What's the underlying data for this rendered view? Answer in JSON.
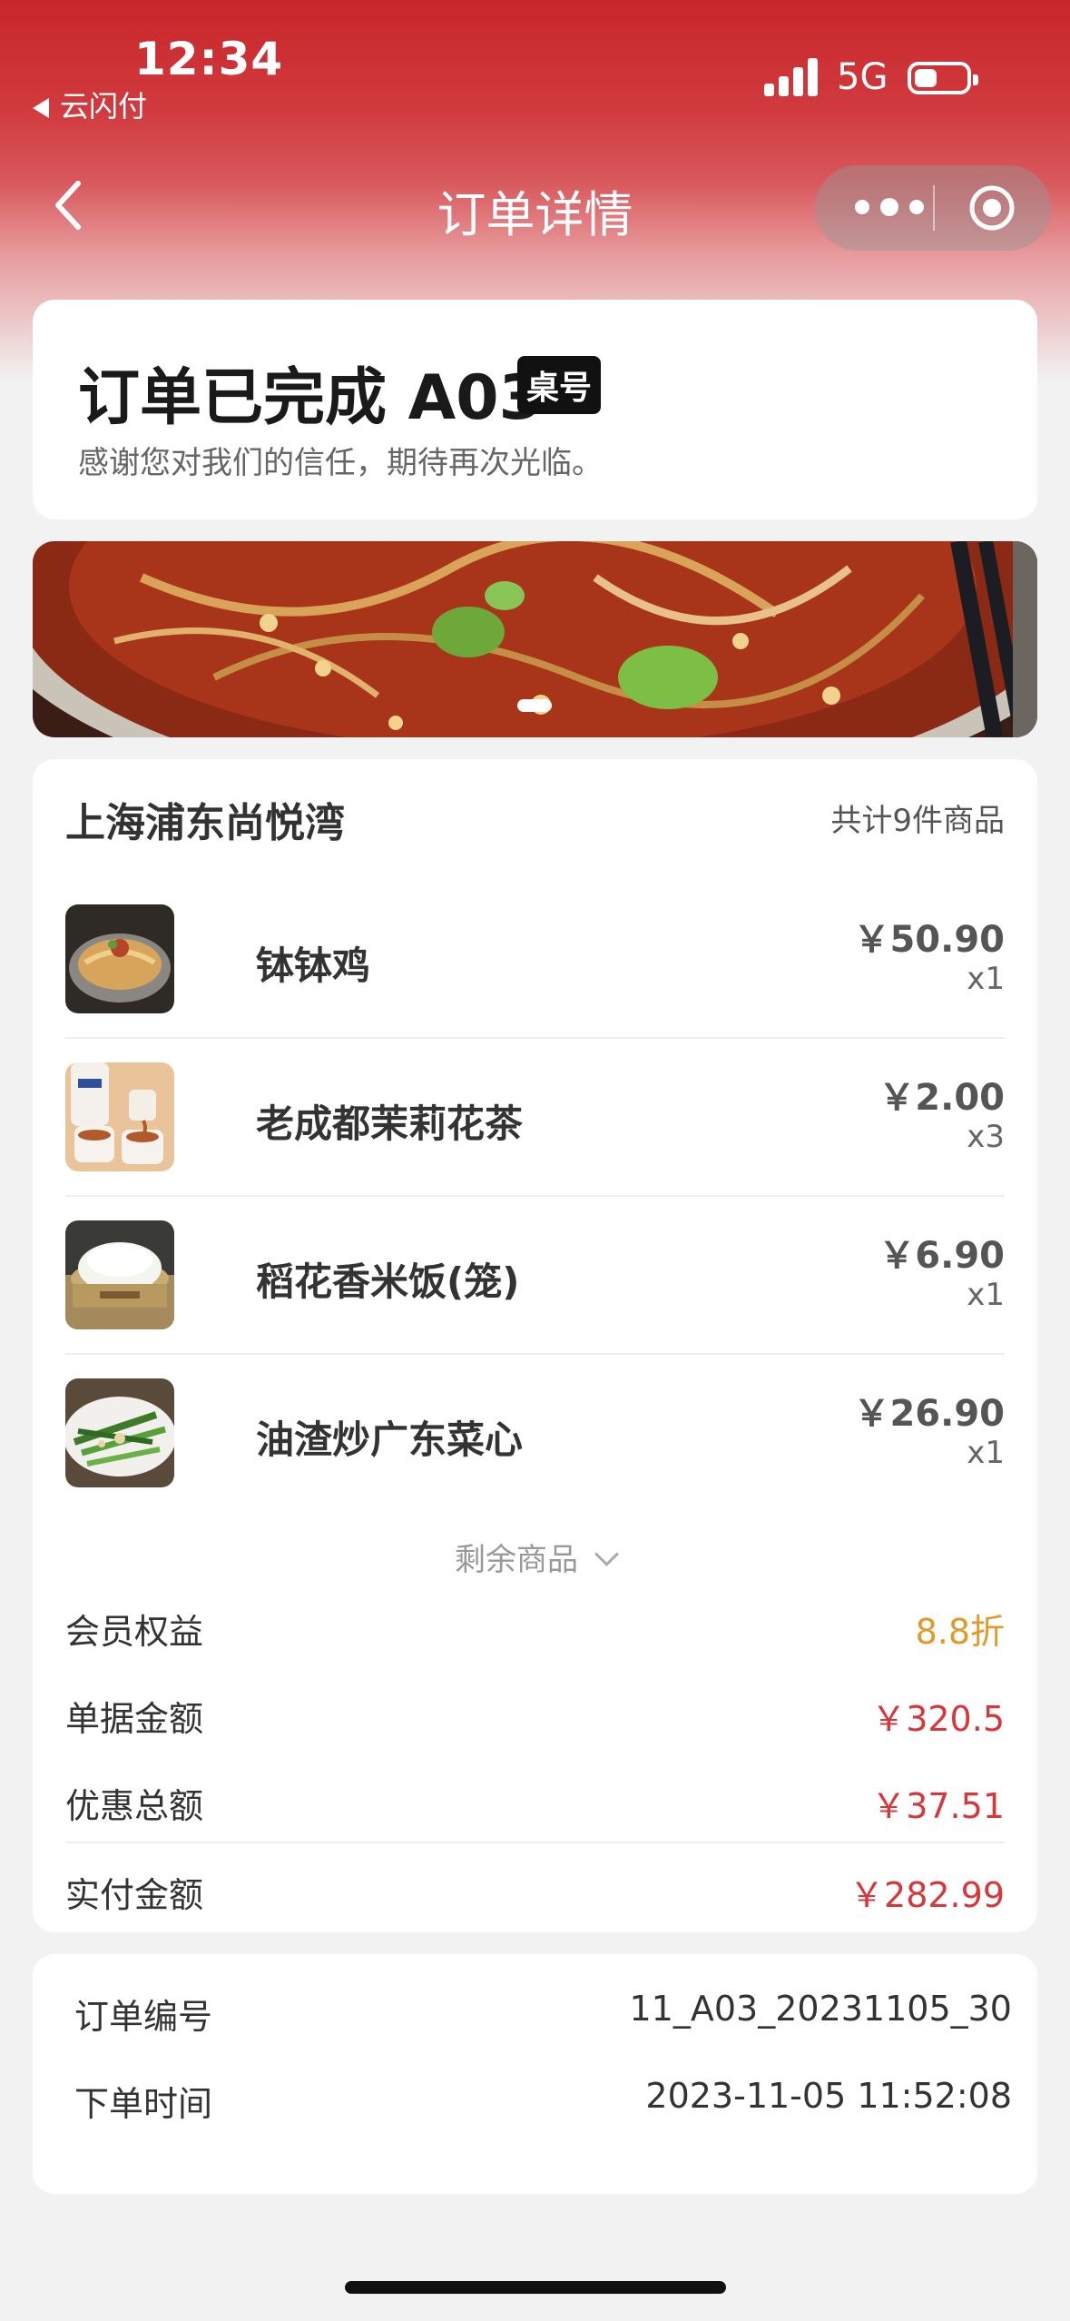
{
  "status_bar": {
    "time": "12:34",
    "back_app": "云闪付",
    "network": "5G"
  },
  "nav": {
    "title": "订单详情"
  },
  "order_status": {
    "title": "订单已完成 A03",
    "badge": "桌号",
    "message": "感谢您对我们的信任，期待再次光临。"
  },
  "store": {
    "name": "上海浦东尚悦湾",
    "item_count": "共计9件商品"
  },
  "items": [
    {
      "name": "钵钵鸡",
      "price": "￥50.90",
      "qty": "x1"
    },
    {
      "name": "老成都茉莉花茶",
      "price": "￥2.00",
      "qty": "x3"
    },
    {
      "name": "稻花香米饭(笼)",
      "price": "￥6.90",
      "qty": "x1"
    },
    {
      "name": "油渣炒广东菜心",
      "price": "￥26.90",
      "qty": "x1"
    }
  ],
  "more_items_label": "剩余商品",
  "summary": [
    {
      "label": "会员权益",
      "value": "8.8折",
      "color": "#e09a2c"
    },
    {
      "label": "单据金额",
      "value": "￥320.5",
      "color": "#d8373a"
    },
    {
      "label": "优惠总额",
      "value": "￥37.51",
      "color": "#d8373a"
    },
    {
      "label": "实付金额",
      "value": "￥282.99",
      "color": "#d8373a"
    }
  ],
  "order_info": [
    {
      "label": "订单编号",
      "value": "11_A03_20231105_30"
    },
    {
      "label": "下单时间",
      "value": "2023-11-05 11:52:08"
    }
  ]
}
